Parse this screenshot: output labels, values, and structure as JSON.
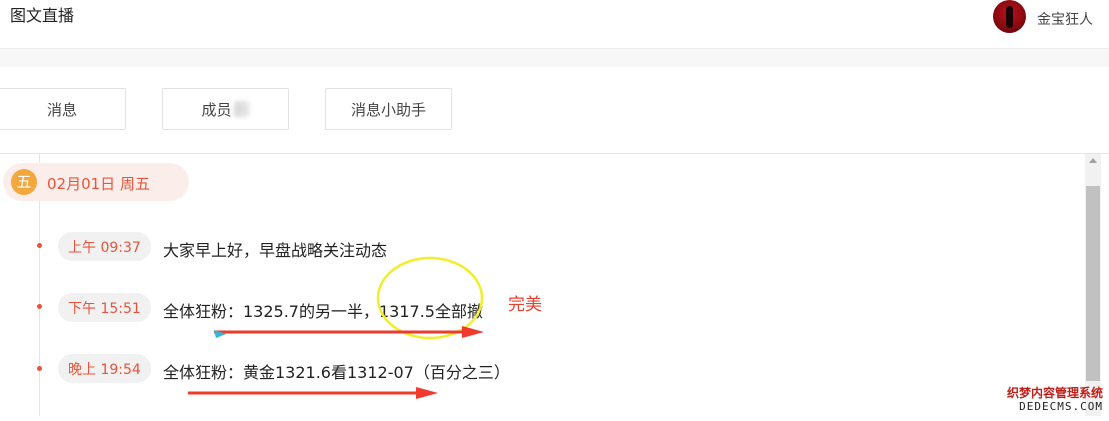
{
  "header": {
    "title": "图文直播",
    "username": "金宝狂人"
  },
  "tabs": [
    {
      "label": "消息"
    },
    {
      "label": "成员"
    },
    {
      "label": "消息小助手"
    }
  ],
  "timeline": {
    "day_badge": "五",
    "date": "02月01日 周五",
    "items": [
      {
        "time": "上午 09:37",
        "text": "大家早上好，早盘战略关注动态"
      },
      {
        "time": "下午 15:51",
        "text": "全体狂粉：1325.7的另一半，1317.5全部撤"
      },
      {
        "time": "晚上 19:54",
        "text": "全体狂粉：黄金1321.6看1312-07（百分之三）"
      }
    ]
  },
  "annotations": {
    "note": "完美",
    "arrow_color": "#f03a2e",
    "circle_color": "#f2ee2a"
  },
  "watermark": {
    "cn": "织梦内容管理系统",
    "en": "DEDECMS.COM"
  },
  "colors": {
    "accent": "#e8543b",
    "badge": "#f2a83a"
  }
}
